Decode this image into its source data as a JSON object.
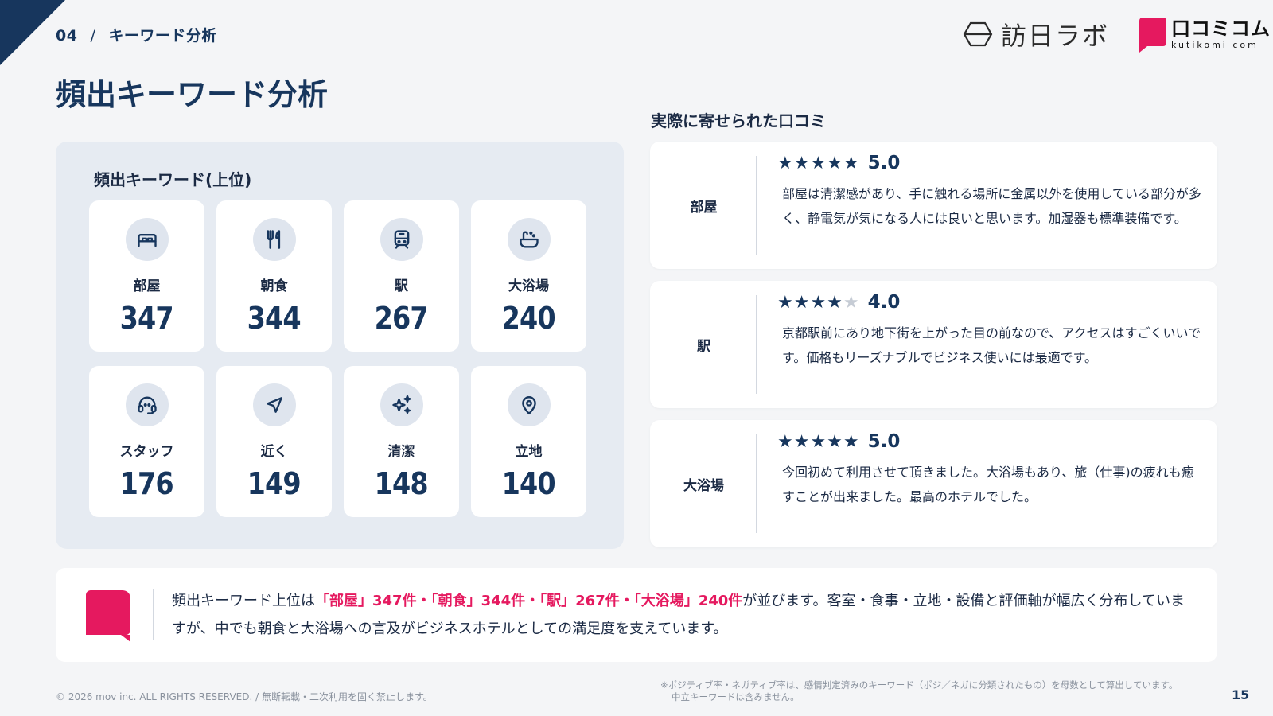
{
  "header": {
    "section_number": "04",
    "separator": "/",
    "section_name": "キーワード分析",
    "brand1": "訪日ラボ",
    "brand2_jp": "口コミコム",
    "brand2_en": "kutikomi com"
  },
  "page_title": "頻出キーワード分析",
  "keywords_panel": {
    "title": "頻出キーワード(上位)",
    "items": [
      {
        "label": "部屋",
        "count": "347",
        "icon": "bed-icon"
      },
      {
        "label": "朝食",
        "count": "344",
        "icon": "fork-knife-icon"
      },
      {
        "label": "駅",
        "count": "267",
        "icon": "train-icon"
      },
      {
        "label": "大浴場",
        "count": "240",
        "icon": "bath-icon"
      },
      {
        "label": "スタッフ",
        "count": "176",
        "icon": "headset-icon"
      },
      {
        "label": "近く",
        "count": "149",
        "icon": "navigation-icon"
      },
      {
        "label": "清潔",
        "count": "148",
        "icon": "sparkles-icon"
      },
      {
        "label": "立地",
        "count": "140",
        "icon": "map-pin-icon"
      }
    ]
  },
  "reviews": {
    "title": "実際に寄せられた口コミ",
    "items": [
      {
        "keyword": "部屋",
        "stars": 5,
        "score": "5.0",
        "text": "部屋は清潔感があり、手に触れる場所に金属以外を使用している部分が多く、静電気が気になる人には良いと思います。加湿器も標準装備です。"
      },
      {
        "keyword": "駅",
        "stars": 4,
        "score": "4.0",
        "text": "京都駅前にあり地下街を上がった目の前なので、アクセスはすごくいいです。価格もリーズナブルでビジネス使いには最適です。"
      },
      {
        "keyword": "大浴場",
        "stars": 5,
        "score": "5.0",
        "text": "今回初めて利用させて頂きました。大浴場もあり、旅（仕事)の疲れも癒すことが出来ました。最高のホテルでした。"
      }
    ]
  },
  "summary": {
    "prefix": "頻出キーワード上位は",
    "highlight1": "「部屋」347件・「朝食」344件・「駅」267件・「大浴場」240件",
    "suffix": "が並びます。客室・食事・立地・設備と評価軸が幅広く分布していますが、中でも朝食と大浴場への言及がビジネスホテルとしての満足度を支えています。"
  },
  "footer": {
    "copyright": "© 2026 mov inc. ALL RIGHTS RESERVED. / 無断転載・二次利用を固く禁止します。",
    "note_line1": "※ポジティブ率・ネガティブ率は、感情判定済みのキーワード（ポジ／ネガに分類されたもの）を母数として算出しています。",
    "note_line2": "中立キーワードは含みません。",
    "page_number": "15"
  },
  "colors": {
    "navy": "#17365d",
    "accent_pink": "#e5195f",
    "panel_bg": "#e6ebf2",
    "page_bg": "#f4f5f7"
  }
}
